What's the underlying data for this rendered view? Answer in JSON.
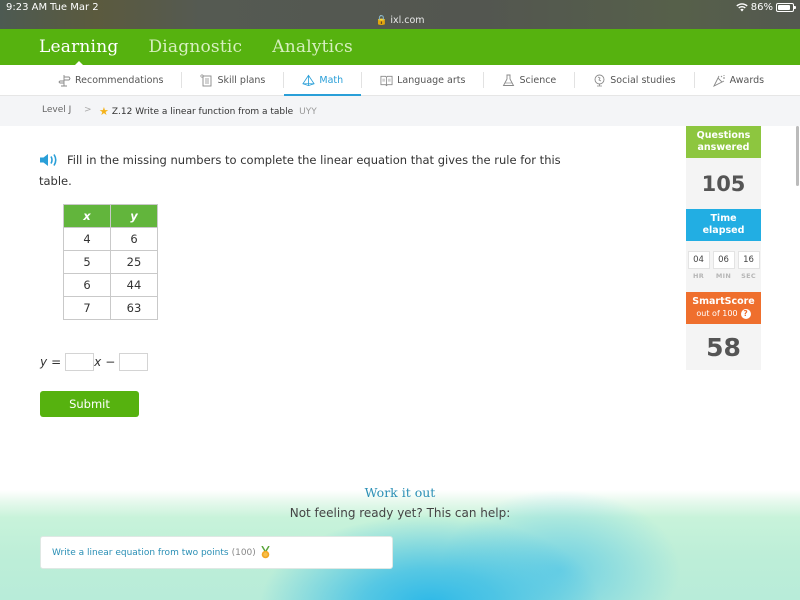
{
  "status_bar": {
    "time": "9:23 AM",
    "date": "Tue Mar 2",
    "url": "ixl.com",
    "battery": "86%",
    "battery_level": 0.86
  },
  "top_nav": {
    "tabs": [
      {
        "label": "Learning",
        "active": true
      },
      {
        "label": "Diagnostic",
        "active": false
      },
      {
        "label": "Analytics",
        "active": false
      }
    ]
  },
  "subjects": [
    {
      "label": "Recommendations",
      "icon": "signpost-icon"
    },
    {
      "label": "Skill plans",
      "icon": "checklist-icon"
    },
    {
      "label": "Math",
      "icon": "pyramid-icon",
      "active": true
    },
    {
      "label": "Language arts",
      "icon": "book-icon"
    },
    {
      "label": "Science",
      "icon": "flask-icon"
    },
    {
      "label": "Social studies",
      "icon": "globe-icon"
    },
    {
      "label": "Awards",
      "icon": "trophy-icon"
    }
  ],
  "breadcrumb": {
    "level": "Level J",
    "separator": ">",
    "skill": "Z.12 Write a linear function from a table",
    "code": "UYY"
  },
  "question": {
    "prompt": "Fill in the missing numbers to complete the linear equation that gives the rule for this table.",
    "table": {
      "headers": [
        "x",
        "y"
      ],
      "rows": [
        [
          "4",
          "6"
        ],
        [
          "5",
          "25"
        ],
        [
          "6",
          "44"
        ],
        [
          "7",
          "63"
        ]
      ]
    },
    "equation": {
      "lhs": "y",
      "equals": "=",
      "var": "x",
      "operator": "−",
      "answer1": "",
      "answer2": ""
    },
    "submit_label": "Submit"
  },
  "stats": {
    "questions_answered_label_1": "Questions",
    "questions_answered_label_2": "answered",
    "questions_answered": "105",
    "time_elapsed_label_1": "Time",
    "time_elapsed_label_2": "elapsed",
    "time": {
      "hr": "04",
      "min": "06",
      "sec": "16"
    },
    "time_units": {
      "hr": "HR",
      "min": "MIN",
      "sec": "SEC"
    },
    "smartscore_label": "SmartScore",
    "smartscore_sub": "out of 100",
    "help_glyph": "?",
    "smartscore": "58"
  },
  "work_it_out": {
    "title": "Work it out",
    "subtitle": "Not feeling ready yet? This can help:",
    "suggestion": "Write a linear equation from two points",
    "suggestion_score": "(100)"
  },
  "colors": {
    "brand_green": "#56b20f",
    "accent_blue": "#2a9fd8",
    "questions_green": "#8dc63f",
    "time_blue": "#22aee3",
    "smartscore_orange": "#ef6f2d"
  }
}
